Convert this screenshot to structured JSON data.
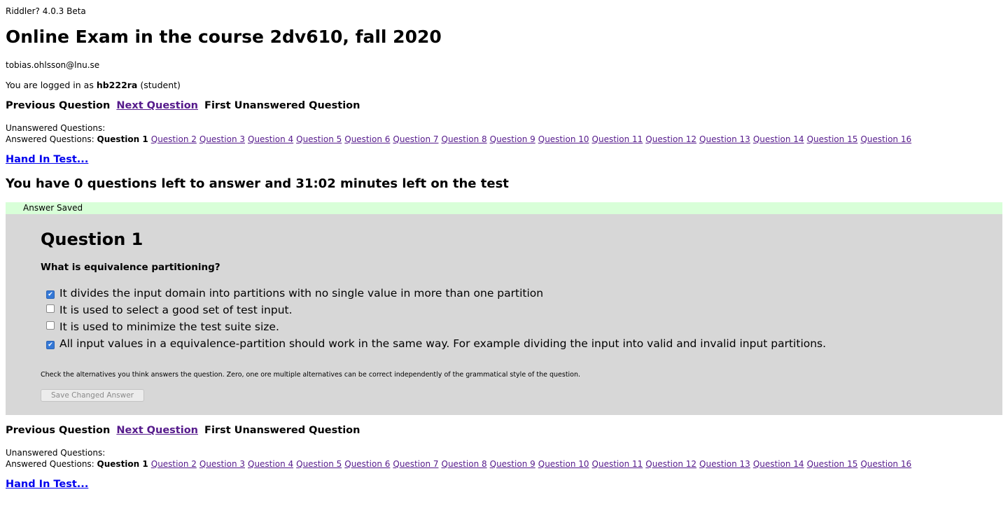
{
  "app": {
    "version_label": "Riddler? 4.0.3 Beta"
  },
  "header": {
    "title": "Online Exam in the course 2dv610, fall 2020",
    "email": "tobias.ohlsson@lnu.se",
    "login_prefix": "You are logged in as",
    "username": "hb222ra",
    "role": "(student)"
  },
  "nav": {
    "previous": "Previous Question",
    "next": "Next Question",
    "first_unanswered": "First Unanswered Question"
  },
  "question_list": {
    "unanswered_label": "Unanswered Questions:",
    "answered_label": "Answered Questions:",
    "current": "Question 1",
    "answered": [
      "Question 2",
      "Question 3",
      "Question 4",
      "Question 5",
      "Question 6",
      "Question 7",
      "Question 8",
      "Question 9",
      "Question 10",
      "Question 11",
      "Question 12",
      "Question 13",
      "Question 14",
      "Question 15",
      "Question 16"
    ]
  },
  "hand_in": "Hand In Test...",
  "status_line": "You have 0 questions left to answer and 31:02 minutes left on the test",
  "saved_notice": "Answer Saved",
  "question": {
    "title": "Question 1",
    "text": "What is equivalence partitioning?",
    "alternatives": [
      {
        "label": "It divides the input domain into partitions with no single value in more than one partition",
        "checked": true
      },
      {
        "label": "It is used to select a good set of test input.",
        "checked": false
      },
      {
        "label": "It is used to minimize the test suite size.",
        "checked": false
      },
      {
        "label": "All input values in a equivalence-partition should work in the same way. For example dividing the input into valid and invalid input partitions.",
        "checked": true
      }
    ],
    "hint": "Check the alternatives you think answers the question. Zero, one ore multiple alternatives can be correct independently of the grammatical style of the question.",
    "save_button": "Save Changed Answer"
  },
  "colors": {
    "saved_bar": "#d8ffd8",
    "panel": "#d7d7d7",
    "visited_link": "#551a8b",
    "link": "#0000ee",
    "checkbox_checked": "#3478d6"
  }
}
